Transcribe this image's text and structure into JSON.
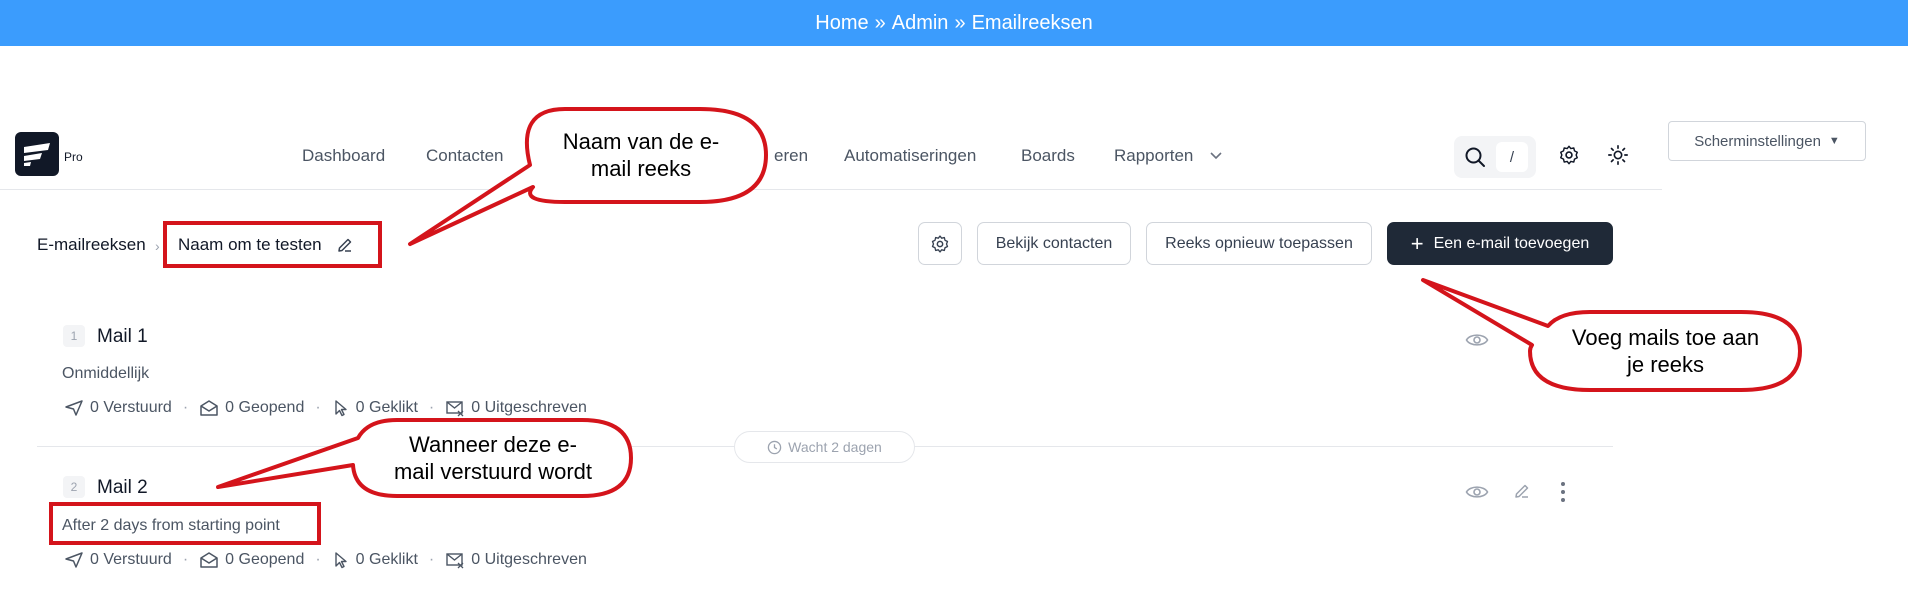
{
  "banner": {
    "home": "Home",
    "sep1": "»",
    "admin": "Admin",
    "sep2": "»",
    "page": "Emailreeksen"
  },
  "brand": {
    "badge": "Pro"
  },
  "nav": {
    "dashboard": "Dashboard",
    "contacten": "Contacten",
    "partial": "eren",
    "automatiseringen": "Automatiseringen",
    "boards": "Boards",
    "rapporten": "Rapporten"
  },
  "search": {
    "shortcut": "/"
  },
  "screen_settings": {
    "label": "Scherminstellingen",
    "arrow": "▼"
  },
  "breadcrumb": {
    "section": "E-mailreeksen",
    "chevron": "›",
    "sequence_name": "Naam om te testen"
  },
  "actions": {
    "view_contacts": "Bekijk contacten",
    "reapply": "Reeks opnieuw toepassen",
    "add_email": "Een e-mail toevoegen",
    "add_icon": "+"
  },
  "mails": [
    {
      "number": "1",
      "title": "Mail 1",
      "timing": "Onmiddellijk",
      "stats": {
        "sent": "0 Verstuurd",
        "opened": "0 Geopend",
        "clicked": "0 Geklikt",
        "unsubscribed": "0 Uitgeschreven"
      }
    },
    {
      "number": "2",
      "title": "Mail 2",
      "timing": "After 2 days from starting point",
      "stats": {
        "sent": "0 Verstuurd",
        "opened": "0 Geopend",
        "clicked": "0 Geklikt",
        "unsubscribed": "0 Uitgeschreven"
      }
    }
  ],
  "stat_separator": "·",
  "wait": {
    "label": "Wacht 2 dagen"
  },
  "annotations": {
    "name_line1": "Naam van de e-",
    "name_line2": "mail reeks",
    "add_line1": "Voeg mails toe aan",
    "add_line2": "je reeks",
    "when_line1": "Wanneer deze e-",
    "when_line2": "mail verstuurd wordt"
  },
  "colors": {
    "banner": "#3b9cfd",
    "annotation_red": "#d4141b",
    "dark_button": "#1f2937"
  }
}
